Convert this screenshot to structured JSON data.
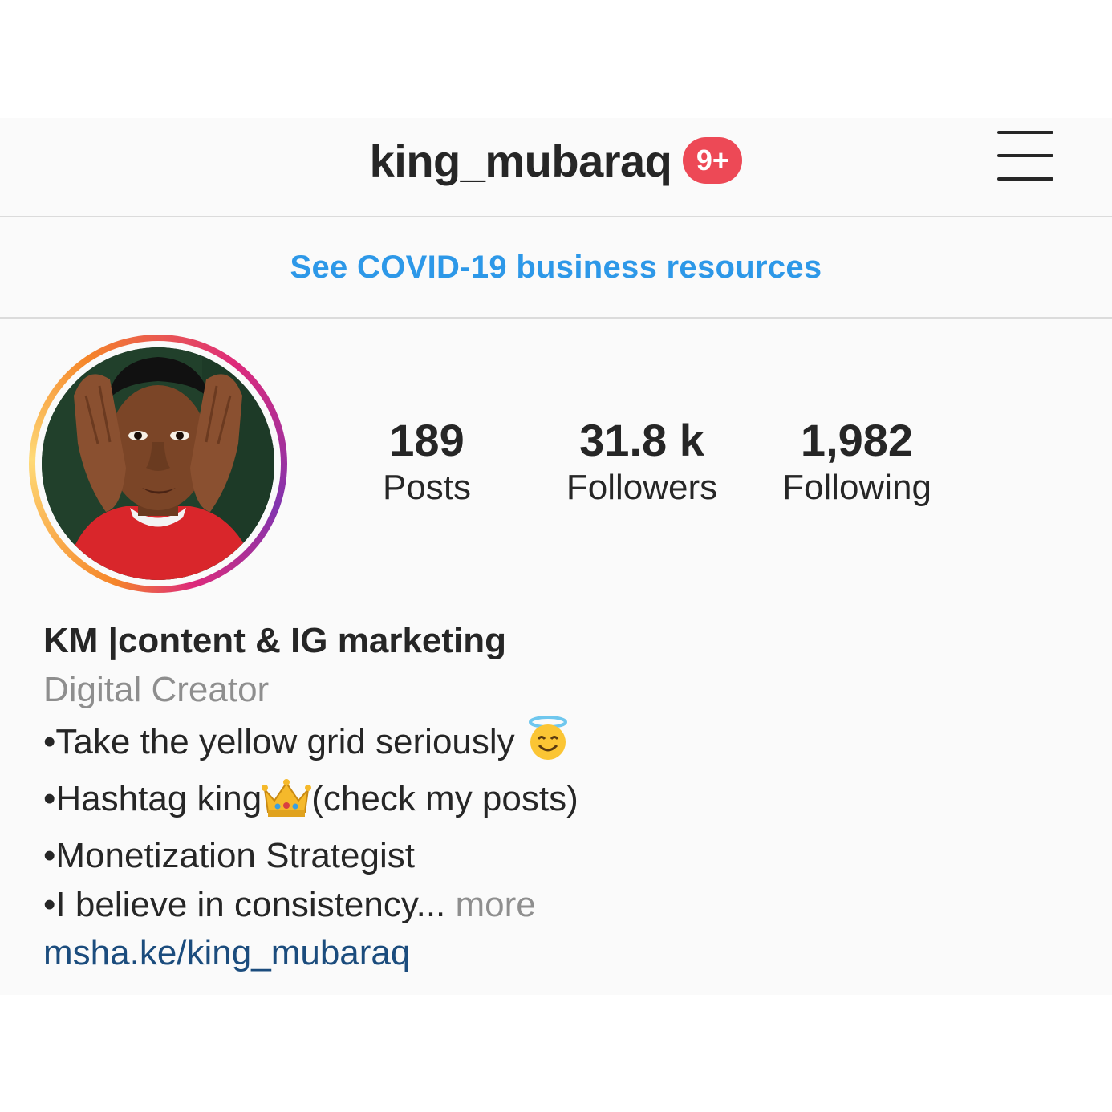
{
  "header": {
    "username": "king_mubaraq",
    "notification_badge": "9+",
    "badge_color": "#ed4956"
  },
  "banner": {
    "link_text": "See COVID-19 business resources",
    "link_color": "#2d98e8"
  },
  "profile": {
    "avatar_icon": "profile-photo",
    "stats": [
      {
        "value": "189",
        "label": "Posts"
      },
      {
        "value": "31.8 k",
        "label": "Followers"
      },
      {
        "value": "1,982",
        "label": "Following"
      }
    ]
  },
  "bio": {
    "name": "KM |content & IG marketing",
    "category": "Digital Creator",
    "lines": [
      "•Take the yellow grid seriously",
      "•Hashtag king",
      "(check my posts)",
      "•Monetization Strategist",
      "•I believe in consistency..."
    ],
    "more_label": " more",
    "website": "msha.ke/king_mubaraq",
    "link_color": "#1b4c7d"
  },
  "icons": {
    "menu": "hamburger-menu-icon",
    "halo_emoji": "smiling-face-with-halo-icon",
    "crown_emoji": "crown-icon"
  }
}
